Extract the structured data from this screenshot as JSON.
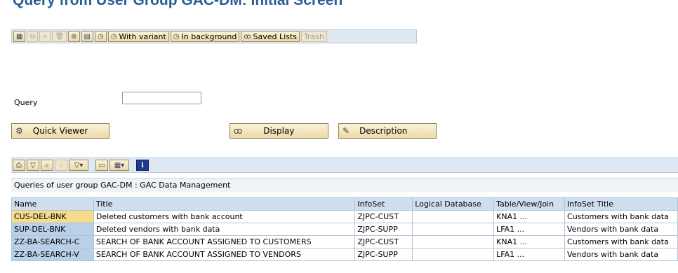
{
  "window": {
    "title": "Query from User Group GAC-DM: Initial Screen"
  },
  "toolbar": {
    "icons": [
      {
        "name": "execute-icon",
        "glyph": "▦",
        "disabled": false
      },
      {
        "name": "copy-icon",
        "glyph": "⧉",
        "disabled": true
      },
      {
        "name": "rename-icon",
        "glyph": "»",
        "disabled": true
      },
      {
        "name": "delete-icon",
        "glyph": "🗑",
        "disabled": true
      },
      {
        "name": "infoset-icon",
        "glyph": "⊕",
        "disabled": false
      },
      {
        "name": "layout-icon",
        "glyph": "▤",
        "disabled": false
      },
      {
        "name": "execute-clock-icon",
        "glyph": "◷",
        "disabled": false
      }
    ],
    "with_variant": "With variant",
    "in_background": "In background",
    "saved_lists": "Saved Lists",
    "trash": "Trash"
  },
  "form": {
    "query_label": "Query",
    "query_value": ""
  },
  "buttons": {
    "quick_viewer": "Quick Viewer",
    "display": "Display",
    "description": "Description"
  },
  "alv": {
    "title": "Queries of user group GAC-DM : GAC Data Management",
    "columns": [
      "Name",
      "Title",
      "InfoSet",
      "Logical Database",
      "Table/View/Join",
      "InfoSet Title"
    ],
    "rows": [
      [
        "CUS-DEL-BNK",
        "Deleted customers with bank account",
        "ZJPC-CUST",
        "",
        "KNA1 ...",
        "Customers with bank data"
      ],
      [
        "SUP-DEL-BNK",
        "Deleted vendors with bank data",
        "ZJPC-SUPP",
        "",
        "LFA1 ...",
        "Vendors with bank data"
      ],
      [
        "ZZ-BA-SEARCH-C",
        "SEARCH OF BANK ACCOUNT ASSIGNED TO CUSTOMERS",
        "ZJPC-CUST",
        "",
        "KNA1 ...",
        "Customers with bank data"
      ],
      [
        "ZZ-BA-SEARCH-V",
        "SEARCH OF BANK ACCOUNT ASSIGNED TO VENDORS",
        "ZJPC-SUPP",
        "",
        "LFA1 ...",
        "Vendors with bank data"
      ]
    ],
    "selected_row": 0
  }
}
